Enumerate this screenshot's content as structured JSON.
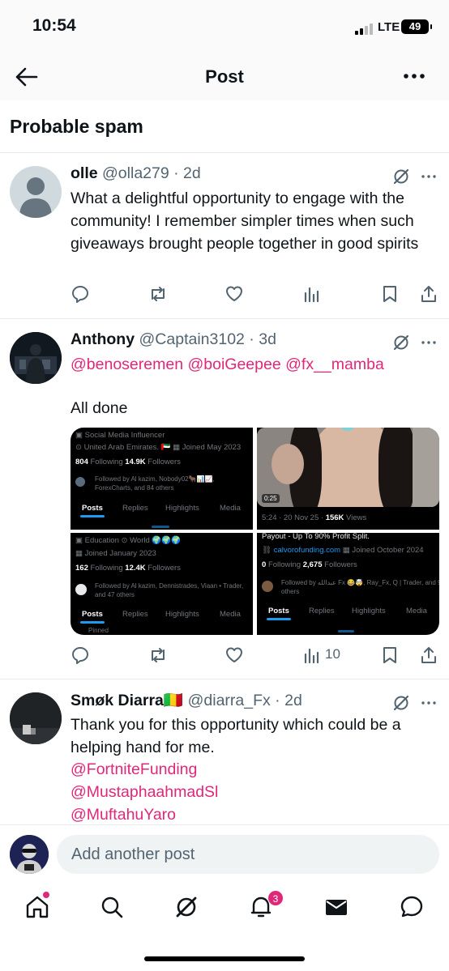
{
  "status_bar": {
    "time": "10:54",
    "network": "LTE",
    "battery": "49"
  },
  "header": {
    "title": "Post"
  },
  "section_title": "Probable spam",
  "posts": [
    {
      "name": "olle",
      "handle": "@olla279",
      "time": "2d",
      "text": "What a delightful opportunity to engage with the community! I remember simpler times when such giveaways brought people together in good spirits",
      "views": ""
    },
    {
      "name": "Anthony",
      "handle": "@Captain3102",
      "time": "3d",
      "mentions": [
        "@benoseremen",
        "@boiGeepee",
        "@fx__mamba"
      ],
      "text": "All done",
      "views": "10",
      "media": {
        "tile1": {
          "category": "Social Media Influencer",
          "location": "United Arab Emirates. 🇦🇪",
          "joined": "Joined May 2023",
          "following_count": "804",
          "following_label": "Following",
          "followers_count": "14.9K",
          "followers_label": "Followers",
          "followed_by": "Followed by Al kazim, Nobody02🐂📊📈,",
          "followed_by_2": "ForexCharts, and 84 others",
          "tabs": [
            "Posts",
            "Replies",
            "Highlights",
            "Media"
          ]
        },
        "tile2": {
          "duration": "0:25",
          "meta": "5:24 · 20 Nov 25 ·",
          "views_count": "156K",
          "views_label": "Views"
        },
        "tile3": {
          "category": "Education",
          "location": "World 🌍🌍🌍",
          "joined": "Joined January 2023",
          "following_count": "162",
          "following_label": "Following",
          "followers_count": "12.4K",
          "followers_label": "Followers",
          "followed_by": "Followed by Al kazim, Dennistrades, Viaan • Trader,",
          "followed_by_2": "and 47 others",
          "tabs": [
            "Posts",
            "Replies",
            "Highlights",
            "Media"
          ],
          "pinned": "Pinned"
        },
        "tile4": {
          "bio": "Payout - Up To 90% Profit Split.",
          "link": "calvorofunding.com",
          "joined": "Joined October 2024",
          "following_count": "0",
          "following_label": "Following",
          "followers_count": "2,675",
          "followers_label": "Followers",
          "followed_by": "Followed by عبدالله Fx 😂🤯, Ray_Fx, Q | Trader, and 90",
          "followed_by_2": "others",
          "tabs": [
            "Posts",
            "Replies",
            "Highlights",
            "Media"
          ]
        }
      }
    },
    {
      "name": "Smøk Diarra🇲🇱",
      "handle": "@diarra_Fx",
      "time": "2d",
      "text": "Thank you for this opportunity which could be a helping hand for me.",
      "mentions": [
        "@FortniteFunding",
        "@MustaphaahmadSl",
        "@MuftahuYaro"
      ]
    }
  ],
  "compose": {
    "placeholder": "Add another post"
  },
  "tabbar": {
    "notifications_badge": "3"
  },
  "icons": {
    "back": "arrow-left-icon",
    "more": "more-horizontal-icon",
    "grok": "grok-icon",
    "reply": "reply-icon",
    "repost": "repost-icon",
    "like": "heart-icon",
    "views": "analytics-icon",
    "bookmark": "bookmark-icon",
    "share": "share-icon"
  },
  "colors": {
    "accent": "#e0287b",
    "link": "#1d9bf0",
    "text": "#0f1419",
    "muted": "#536471"
  }
}
